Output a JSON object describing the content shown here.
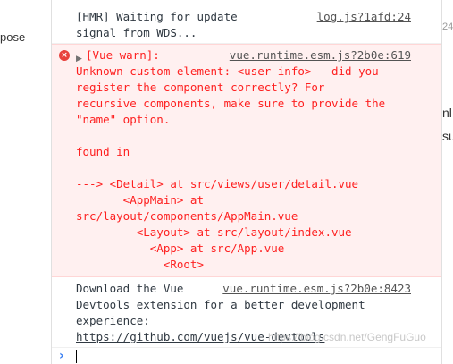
{
  "left_fragment": "pose",
  "right_fragments": {
    "top": "24",
    "mid1": "nl",
    "mid2": "su"
  },
  "messages": [
    {
      "lines": [
        "[HMR] Waiting for update",
        "signal from WDS..."
      ],
      "source": "log.js?1afd:24"
    },
    {
      "icon": "error-icon",
      "toggle": "▶",
      "header": "[Vue warn]:",
      "source": "vue.runtime.esm.js?2b0e:619",
      "lines": [
        "Unknown custom element: <user-info> - did you",
        "register the component correctly? For",
        "recursive components, make sure to provide the",
        "\"name\" option.",
        "",
        "found in",
        "",
        "---> <Detail> at src/views/user/detail.vue",
        "       <AppMain> at",
        "src/layout/components/AppMain.vue",
        "         <Layout> at src/layout/index.vue",
        "           <App> at src/App.vue",
        "             <Root>"
      ]
    },
    {
      "lines": [
        "Download the Vue",
        "Devtools extension for a better development",
        "experience:"
      ],
      "link": "https://github.com/vuejs/vue-devtools",
      "source": "vue.runtime.esm.js?2b0e:8423"
    }
  ],
  "prompt": {
    "symbol": "›"
  },
  "watermark": "https://blog.csdn.net/GengFuGuo",
  "colors": {
    "error_bg": "#fff0f0",
    "error_text": "#fe2020",
    "prompt": "#367cf1"
  }
}
